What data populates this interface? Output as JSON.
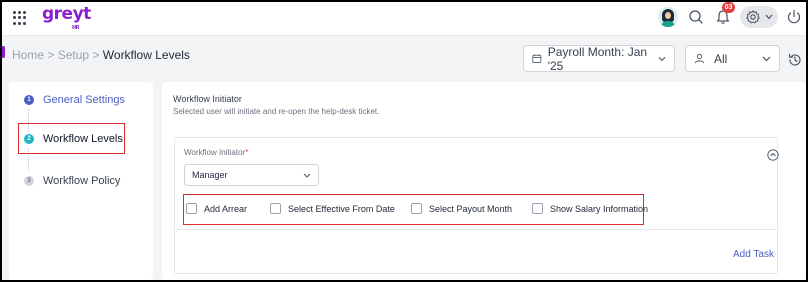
{
  "app": {
    "logo_text": "greyt",
    "logo_sub": "HR",
    "notification_count": "03"
  },
  "breadcrumb": {
    "home": "Home",
    "sep1": ">",
    "setup": "Setup",
    "sep2": ">",
    "current": "Workflow Levels"
  },
  "filters": {
    "payroll_month": "Payroll Month: Jan '25",
    "scope": "All"
  },
  "steps": [
    {
      "num": "1",
      "label": "General Settings"
    },
    {
      "num": "2",
      "label": "Workflow Levels"
    },
    {
      "num": "3",
      "label": "Workflow Policy"
    }
  ],
  "main": {
    "section_title": "Workflow Initiator",
    "section_subtitle": "Selected user will initiate and re-open the help-desk ticket.",
    "field_label": "Workflow Initiator",
    "required_mark": "*",
    "dropdown_value": "Manager",
    "checkboxes": [
      {
        "label": "Add Arrear",
        "checked": false
      },
      {
        "label": "Select Effective From Date",
        "checked": false
      },
      {
        "label": "Select Payout Month",
        "checked": false
      },
      {
        "label": "Show Salary Information",
        "checked": false
      }
    ],
    "add_task_label": "Add Task"
  },
  "colors": {
    "brand": "#8a1fd0",
    "accent": "#4b5ec4",
    "active_step": "#22b5c5",
    "highlight_box": "#d92e2e",
    "badge": "#e53e3e"
  }
}
